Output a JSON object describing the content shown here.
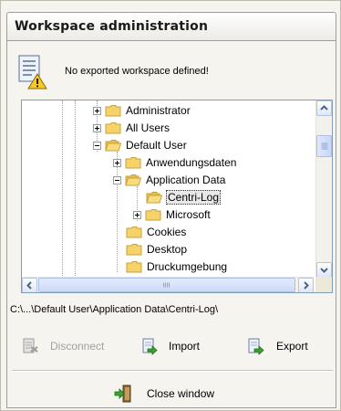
{
  "window": {
    "title": "Workspace administration"
  },
  "message": {
    "text": "No exported workspace defined!",
    "icon": "document-warning-icon"
  },
  "tree": {
    "nodes": [
      {
        "label": "Administrator",
        "expander": "plus"
      },
      {
        "label": "All Users",
        "expander": "plus"
      },
      {
        "label": "Default User",
        "expander": "minus"
      },
      {
        "label": "Anwendungsdaten",
        "expander": "plus"
      },
      {
        "label": "Application Data",
        "expander": "minus"
      },
      {
        "label": "Centri-Log",
        "expander": "none",
        "selected": true
      },
      {
        "label": "Microsoft",
        "expander": "plus"
      },
      {
        "label": "Cookies",
        "expander": "none"
      },
      {
        "label": "Desktop",
        "expander": "none"
      },
      {
        "label": "Druckumgebung",
        "expander": "none"
      }
    ]
  },
  "path": {
    "text": "C:\\...\\Default User\\Application Data\\Centri-Log\\"
  },
  "actions": {
    "disconnect_label": "Disconnect",
    "import_label": "Import",
    "export_label": "Export"
  },
  "close": {
    "label": "Close window"
  },
  "colors": {
    "folder": "#f5d26a",
    "folder_edge": "#c9a23b",
    "accent_green": "#3aa52c"
  }
}
